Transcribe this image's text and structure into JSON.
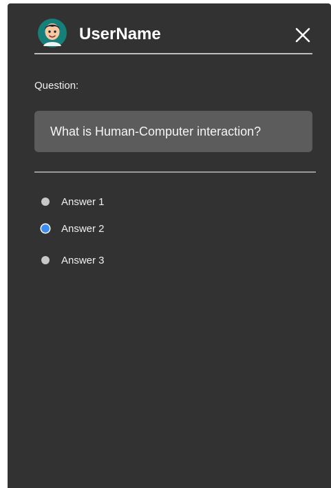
{
  "header": {
    "username": "UserName",
    "avatar_icon": "user-avatar-icon",
    "close_icon": "close-icon"
  },
  "question": {
    "label": "Question:",
    "text": "What is Human-Computer interaction?"
  },
  "answers": [
    {
      "label": "Answer 1",
      "selected": false
    },
    {
      "label": "Answer 2",
      "selected": true
    },
    {
      "label": "Answer 3",
      "selected": false
    }
  ],
  "colors": {
    "panel_bg": "#323232",
    "question_box_bg": "#5c5c5c",
    "radio_selected": "#3d8cf0",
    "radio_unselected": "#c8c8c8",
    "divider": "#bdbdbd"
  }
}
